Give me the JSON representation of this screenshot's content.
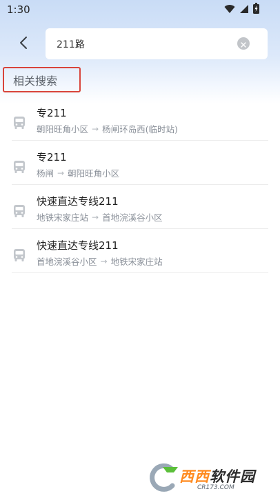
{
  "status_bar": {
    "time": "1:30",
    "icons": [
      "wifi-icon",
      "cellular-signal-icon",
      "battery-charging-icon"
    ]
  },
  "header": {
    "back_icon": "chevron-left-icon",
    "search": {
      "value": "211路",
      "clear_icon": "clear-circle-icon"
    }
  },
  "section": {
    "title": "相关搜索",
    "highlight_color": "#d8443b"
  },
  "results": [
    {
      "name": "专211",
      "from": "朝阳旺角小区",
      "to": "杨闸环岛西(临时站)",
      "icon": "bus-icon"
    },
    {
      "name": "专211",
      "from": "杨闸",
      "to": "朝阳旺角小区",
      "icon": "bus-icon"
    },
    {
      "name": "快速直达专线211",
      "from": "地铁宋家庄站",
      "to": "首地浣溪谷小区",
      "icon": "bus-icon"
    },
    {
      "name": "快速直达专线211",
      "from": "首地浣溪谷小区",
      "to": "地铁宋家庄站",
      "icon": "bus-icon"
    }
  ],
  "route_arrow": "→",
  "watermark": {
    "main": "西西",
    "tail": "软件园",
    "sub": "CR173.COM"
  }
}
